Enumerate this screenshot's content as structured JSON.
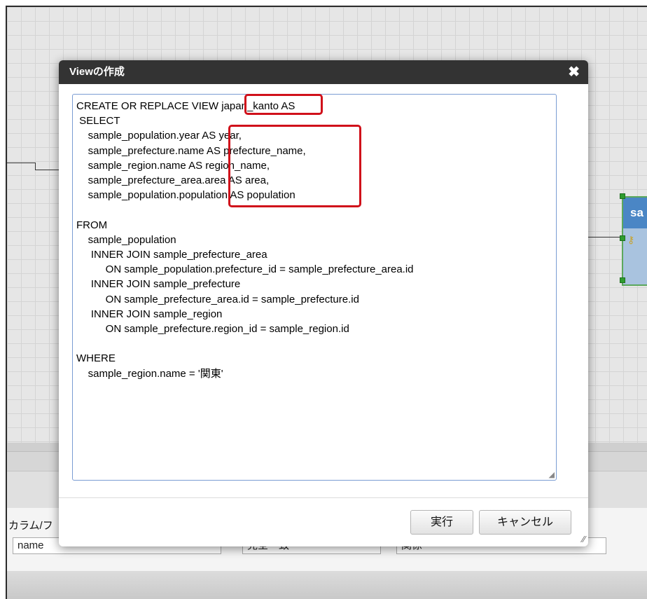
{
  "dialog": {
    "title": "Viewの作成",
    "close_glyph": "✖",
    "sql": "CREATE OR REPLACE VIEW japan_kanto AS\n SELECT\n    sample_population.year AS year,\n    sample_prefecture.name AS prefecture_name,\n    sample_region.name AS region_name,\n    sample_prefecture_area.area AS area,\n    sample_population.population AS population\n\nFROM\n    sample_population\n     INNER JOIN sample_prefecture_area\n          ON sample_population.prefecture_id = sample_prefecture_area.id\n     INNER JOIN sample_prefecture\n          ON sample_prefecture_area.id = sample_prefecture.id\n     INNER JOIN sample_region\n          ON sample_prefecture.region_id = sample_region.id\n\nWHERE\n    sample_region.name = '関東'",
    "execute_label": "実行",
    "cancel_label": "キャンセル"
  },
  "background": {
    "entity_title": "sa",
    "key_icon": "key-icon",
    "property_label": "カラム/フ",
    "column_name_value": "name",
    "column_field2_value": "完全一致",
    "column_field3_value": "関係"
  },
  "colors": {
    "highlight": "#d0101a",
    "dialog_title_bg": "#333333",
    "entity_header": "#4a86c5"
  }
}
